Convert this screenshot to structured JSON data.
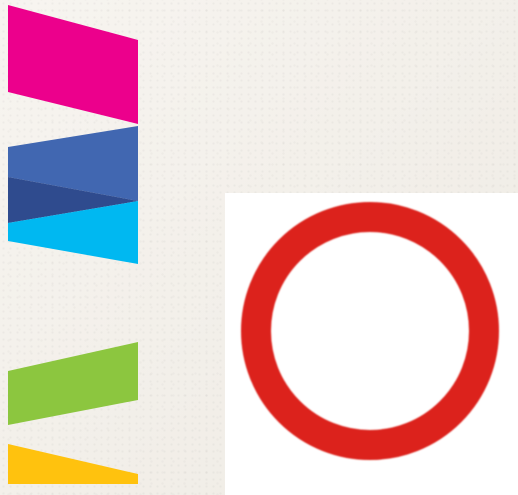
{
  "colors": {
    "background": "#f3efe8",
    "magenta": "#ec008c",
    "blue": "#4167b1",
    "navy": "#2f4b8e",
    "cyan": "#00b8f1",
    "green": "#8cc63f",
    "yellow": "#ffc20e",
    "panel": "#ffffff",
    "ring": "#dc231b"
  },
  "shapes": [
    {
      "name": "magenta-band",
      "color_key": "magenta"
    },
    {
      "name": "blue-band",
      "color_key": "blue"
    },
    {
      "name": "navy-band",
      "color_key": "navy"
    },
    {
      "name": "cyan-band",
      "color_key": "cyan"
    },
    {
      "name": "green-band",
      "color_key": "green"
    },
    {
      "name": "yellow-band",
      "color_key": "yellow"
    }
  ],
  "ring_icon": {
    "icon": "circle-outline-icon",
    "color_key": "ring"
  }
}
